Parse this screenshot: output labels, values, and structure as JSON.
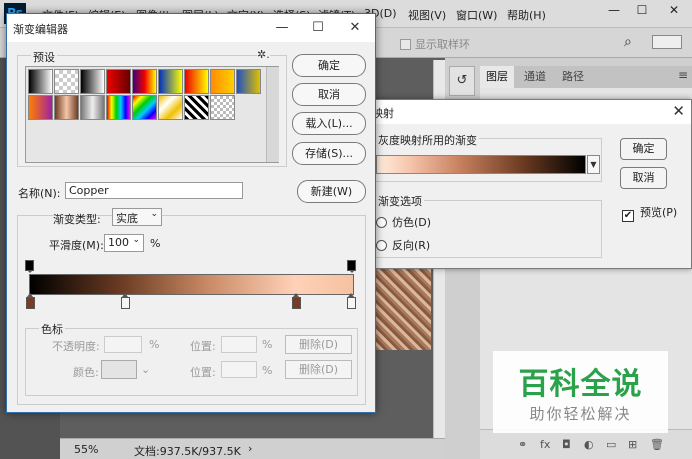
{
  "photoshop": {
    "logo": "Ps",
    "menu": [
      "文件(F)",
      "编辑(E)",
      "图像(I)",
      "图层(L)",
      "文字(Y)",
      "选择(S)",
      "滤镜(T)",
      "3D(D)",
      "视图(V)",
      "窗口(W)",
      "帮助(H)"
    ],
    "window_controls": {
      "minimize": "—",
      "restore": "☐",
      "close": "✕"
    },
    "options_bar": {
      "sample_ring_label": "显示取样环"
    },
    "status": {
      "zoom": "55%",
      "doc_size": "文档:937.5K/937.5K",
      "arrow": "›"
    },
    "panel_tabs": [
      "图层",
      "通道",
      "路径"
    ],
    "panel_menu": "≡"
  },
  "watermark": {
    "main": "百科全说",
    "sub": "助你轻松解决"
  },
  "gradient_map": {
    "title": "映射",
    "close": "✕",
    "group1_label": "灰度映射所用的渐变",
    "group2_label": "渐变选项",
    "option_dither": "仿色(D)",
    "option_reverse": "反向(R)",
    "ok": "确定",
    "cancel": "取消",
    "preview_label": "预览(P)",
    "preview_checked": true
  },
  "gradient_editor": {
    "title": "渐变编辑器",
    "window_controls": {
      "minimize": "—",
      "maximize": "☐",
      "close": "✕"
    },
    "presets_label": "预设",
    "gear": "✲.",
    "buttons": {
      "ok": "确定",
      "cancel": "取消",
      "load": "载入(L)...",
      "save": "存储(S)...",
      "new": "新建(W)"
    },
    "name_label": "名称(N):",
    "name_value": "Copper",
    "type_label": "渐变类型:",
    "type_value": "实底",
    "smooth_label": "平滑度(M):",
    "smooth_value": "100",
    "smooth_unit": "%",
    "stops_label": "色标",
    "opacity_label": "不透明度:",
    "color_label": "颜色:",
    "location_label": "位置:",
    "percent": "%",
    "delete_label": "删除(D)",
    "preset_swatches": [
      "linear-gradient(to right,#000,#fff)",
      "repeating-conic-gradient(#ccc 0 25%,#fff 0 50%) 0 0/8px 8px",
      "linear-gradient(to right,#000,#fff)",
      "linear-gradient(to right,#e00,#600)",
      "linear-gradient(to right,#400080,#e00,#ff0)",
      "linear-gradient(to right,#0030c0,#ff0)",
      "linear-gradient(to right,#e00,#ff0)",
      "linear-gradient(to right,#ff8c00,#ffd000)",
      "linear-gradient(to right,#2050c0,#e0c000)",
      "linear-gradient(to right,#ff8000,#a020a0)",
      "linear-gradient(to right,#6b3b22,#f5c7aa,#6b3b22)",
      "linear-gradient(to right,#777,#eee,#777)",
      "linear-gradient(to right,#e00,#ff0,#0c0,#0cf,#00f,#f0f)",
      "linear-gradient(135deg,#e00,#ff0,#0c0,#0cf,#00f,#f0f)",
      "linear-gradient(135deg,#f0c000,#fff,#f0c000,#fff)",
      "repeating-linear-gradient(45deg,#000 0 3px,#fff 3px 6px)",
      "repeating-conic-gradient(#bbb 0 25%,#fff 0 50%) 0 0/6px 6px"
    ]
  }
}
